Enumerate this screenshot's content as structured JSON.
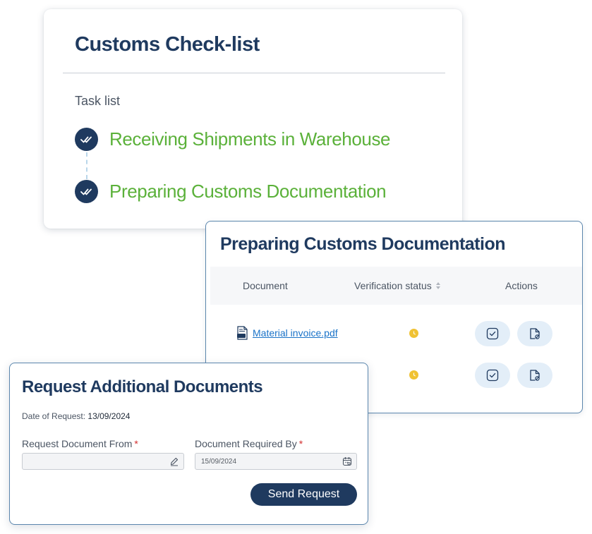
{
  "checklist": {
    "title": "Customs Check-list",
    "task_list_label": "Task list",
    "tasks": [
      {
        "label": "Receiving Shipments in Warehouse",
        "status": "completed"
      },
      {
        "label": "Preparing Customs Documentation",
        "status": "completed"
      }
    ]
  },
  "documents_panel": {
    "title": "Preparing Customs Documentation",
    "columns": [
      "Document",
      "Verification status",
      "Actions"
    ],
    "rows": [
      {
        "document": "Material invoice.pdf",
        "status": "pending",
        "status_color": "#f0c233"
      },
      {
        "document": "",
        "status": "pending",
        "status_color": "#f0c233"
      }
    ]
  },
  "request_form": {
    "title": "Request Additional Documents",
    "date_label": "Date of Request:",
    "date_value": "13/09/2024",
    "fields": [
      {
        "label": "Request Document From",
        "required_mark": "*",
        "value": ""
      },
      {
        "label": "Document Required By",
        "required_mark": "*",
        "value": "15/09/2024"
      }
    ],
    "submit_label": "Send Request"
  },
  "colors": {
    "navy": "#1f3a5f",
    "task_green": "#5bb13a",
    "link_blue": "#1a73c8",
    "pending_yellow": "#f0c233",
    "action_bg": "#e3eef8",
    "required_red": "#d32f2f"
  }
}
